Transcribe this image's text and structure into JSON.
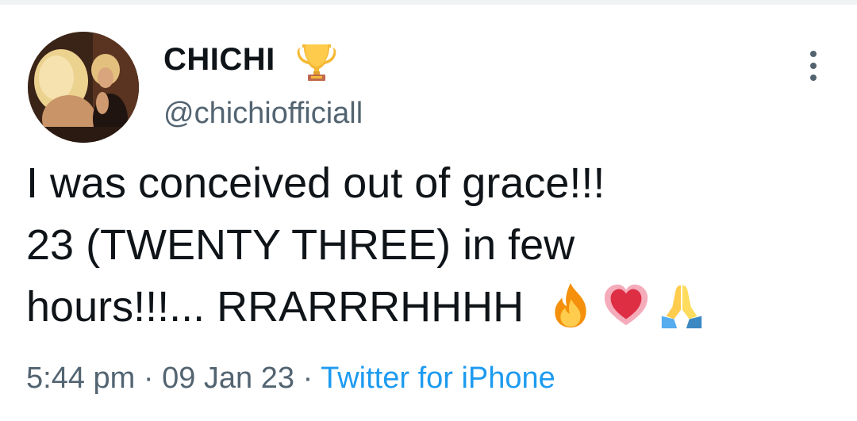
{
  "user": {
    "display_name": "CHICHI",
    "badge_emoji_icon": "trophy-icon",
    "handle": "@chichiofficiall"
  },
  "tweet": {
    "lines": [
      "I was conceived out of grace!!!",
      "23 (TWENTY THREE) in few",
      "hours!!!... RRARRRHHHH"
    ],
    "emojis": [
      "fire-icon",
      "heart-icon",
      "folded-hands-icon"
    ]
  },
  "meta": {
    "time": "5:44 pm",
    "separator": "·",
    "date": "09 Jan 23",
    "source": "Twitter for iPhone"
  },
  "colors": {
    "text": "#0f1419",
    "secondary": "#536471",
    "link": "#1d9bf0"
  }
}
